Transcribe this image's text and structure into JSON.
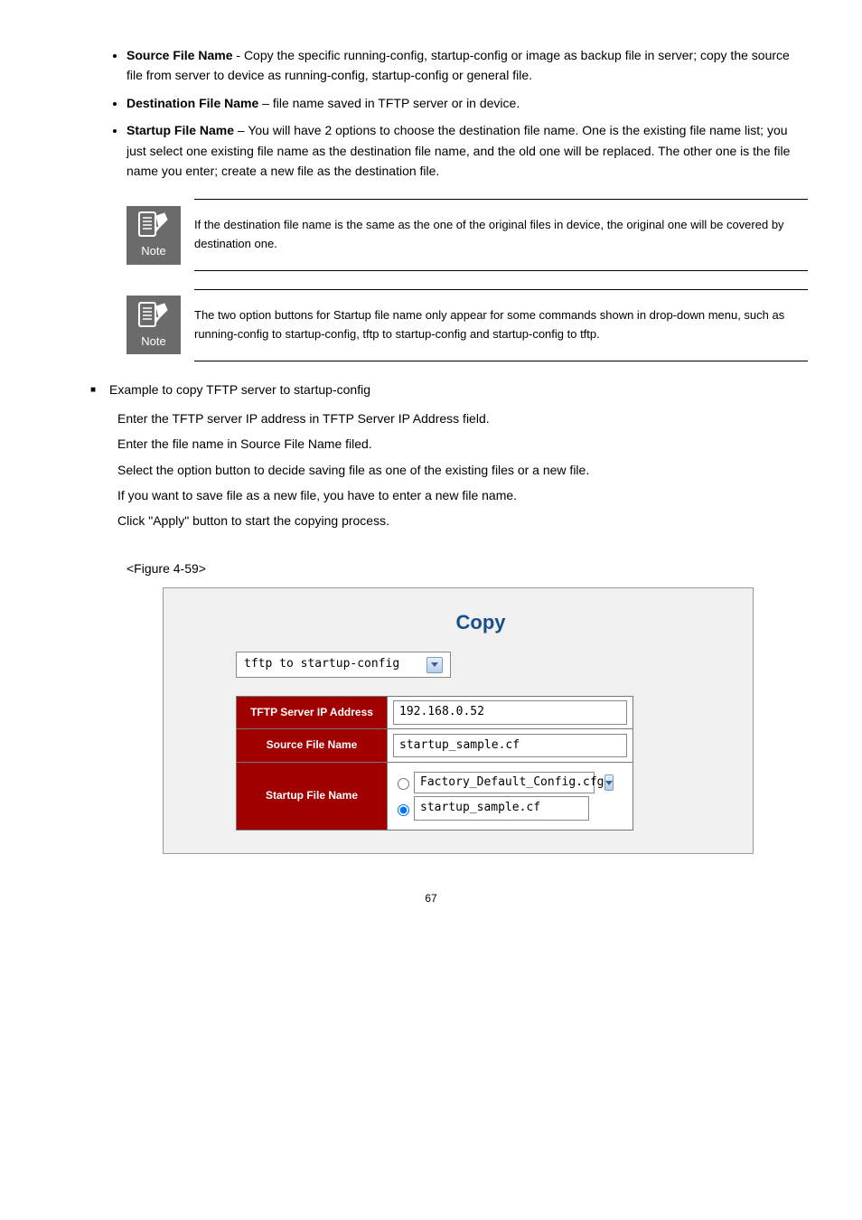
{
  "bulletList": [
    "<b>Source File Name</b> - Copy the specific running-config, startup-config or image as backup file in server; copy the source file from server to device as running-config, startup-config or general file.",
    "<b>Destination File Name</b> – file name saved in TFTP server or in device.",
    "<b>Startup File Name</b> – You will have 2 options to choose the destination file name. One is the existing file name list; you just select one existing file name as the destination file name, and the old one will be replaced. The other one is the file name you enter; create a new file as the destination file."
  ],
  "notes": [
    "If the destination file name is the same as the one of the original files in device, the original one will be covered by destination one.",
    "The two option buttons for Startup file name only appear for some commands shown in drop-down menu, such as running-config to startup-config, tftp to startup-config and startup-config to tftp."
  ],
  "noteLabel": "Note",
  "sectionHeading": "Example to copy TFTP server to startup-config",
  "paragraphs": [
    "Enter the TFTP server IP address in TFTP Server IP Address field.",
    "Enter the file name in Source File Name filed.",
    "Select the option button to decide saving file as one of the existing files or a new file.",
    "If you want to save file as a new file, you have to enter a new file name.",
    "Click \"Apply\" button to start the copying process."
  ],
  "figureLabel": "<Figure 4-59>",
  "screenshot": {
    "title": "Copy",
    "dropdownValue": "tftp to startup-config",
    "rows": {
      "tftpServer": {
        "label": "TFTP Server IP Address",
        "value": "192.168.0.52"
      },
      "sourceFile": {
        "label": "Source File Name",
        "value": "startup_sample.cf"
      },
      "startupFile": {
        "label": "Startup File Name",
        "option1": "Factory_Default_Config.cfg",
        "option2": "startup_sample.cf"
      }
    }
  },
  "pageNumber": "67"
}
